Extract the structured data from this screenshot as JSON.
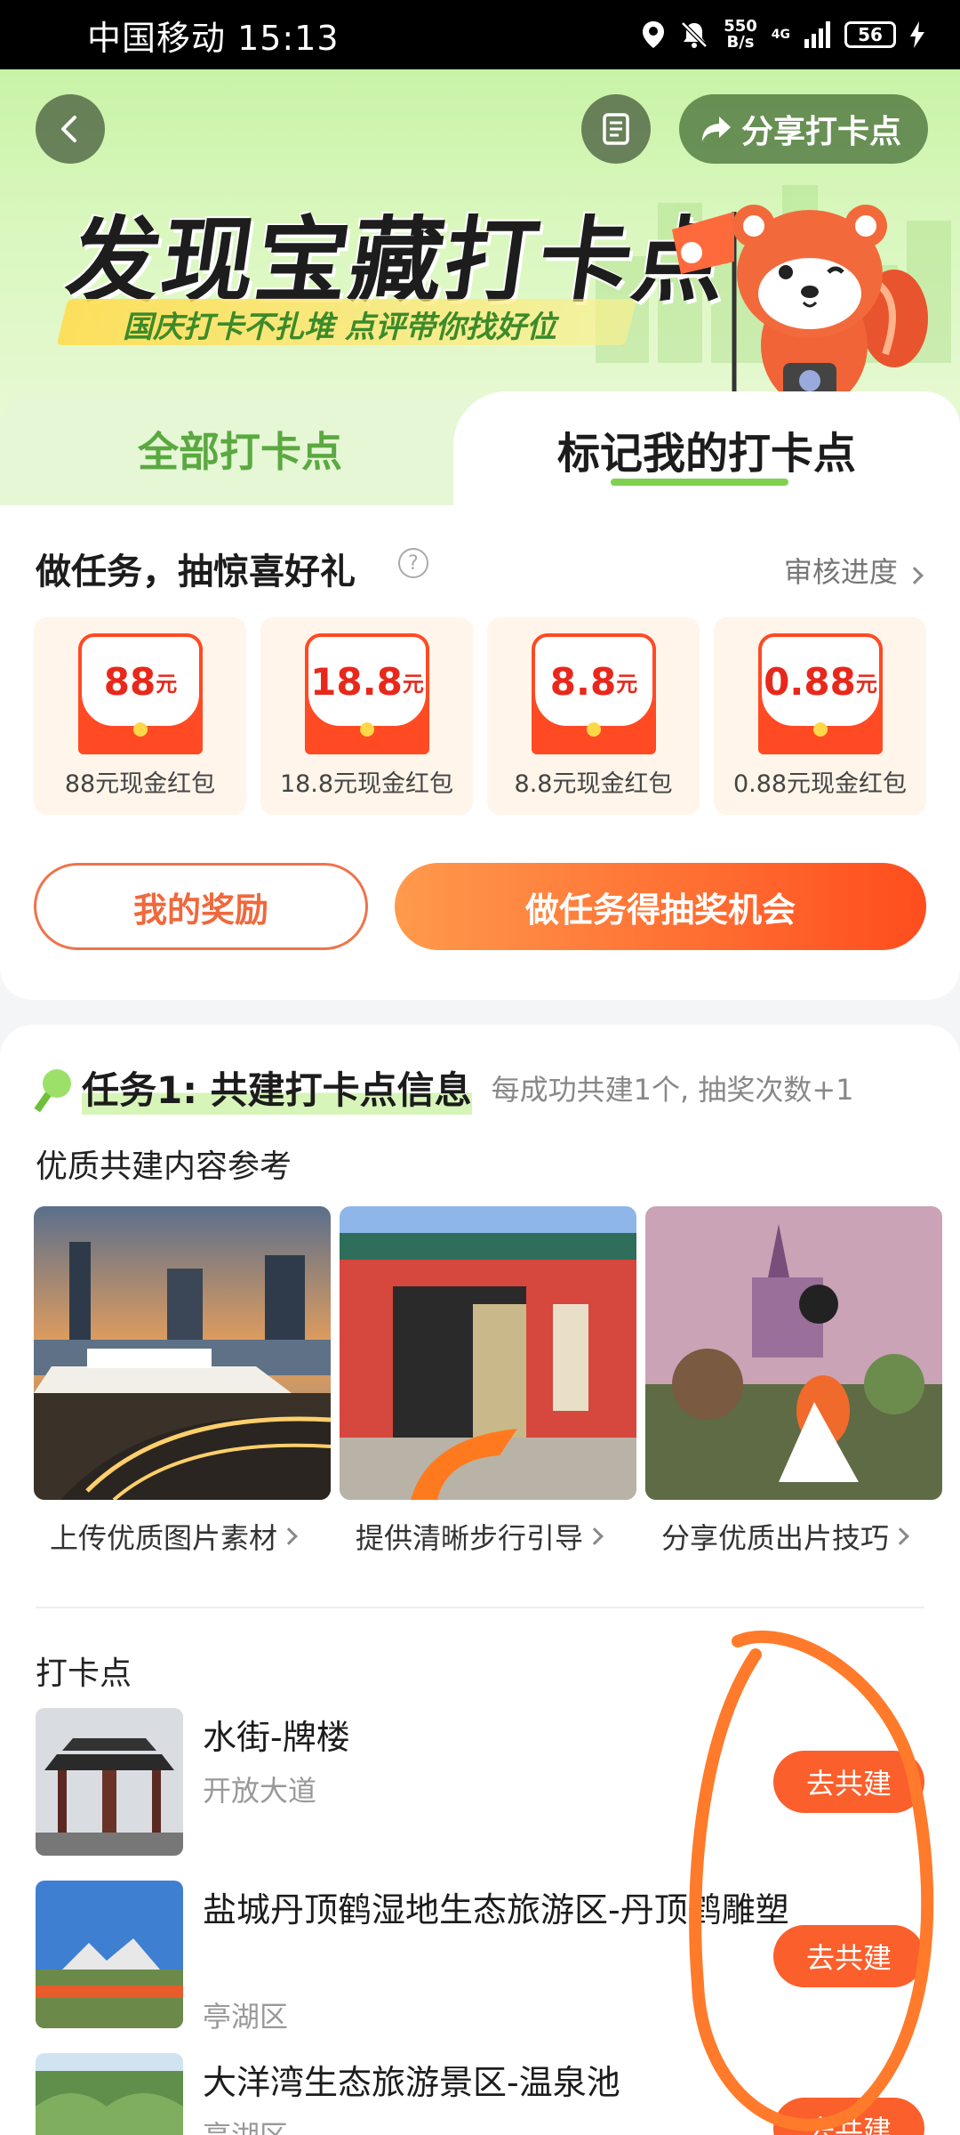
{
  "status_bar": {
    "carrier_time": "中国移动 15:13",
    "net_speed_top": "550",
    "net_speed_bottom": "B/s",
    "network": "4G",
    "battery": "56"
  },
  "header": {
    "share_label": "分享打卡点",
    "title": "发现宝藏打卡点",
    "subtitle": "国庆打卡不扎堆 点评带你找好位"
  },
  "tabs": {
    "all": "全部打卡点",
    "mine": "标记我的打卡点"
  },
  "lottery": {
    "title": "做任务，抽惊喜好礼",
    "review_link": "审核进度",
    "prizes": [
      {
        "amount": "88",
        "unit": "元",
        "label": "88元现金红包"
      },
      {
        "amount": "18.8",
        "unit": "元",
        "label": "18.8元现金红包"
      },
      {
        "amount": "8.8",
        "unit": "元",
        "label": "8.8元现金红包"
      },
      {
        "amount": "0.88",
        "unit": "元",
        "label": "0.88元现金红包"
      }
    ],
    "my_reward": "我的奖励",
    "do_task": "做任务得抽奖机会"
  },
  "task1": {
    "title": "任务1: 共建打卡点信息",
    "desc": "每成功共建1个, 抽奖次数+1",
    "ref_title": "优质共建内容参考",
    "refs": [
      {
        "caption": "上传优质图片素材"
      },
      {
        "caption": "提供清晰步行引导"
      },
      {
        "caption": "分享优质出片技巧"
      }
    ]
  },
  "spots": {
    "title": "打卡点",
    "items": [
      {
        "name": "水街-牌楼",
        "area": "开放大道",
        "action": "去共建"
      },
      {
        "name": "盐城丹顶鹤湿地生态旅游区-丹顶鹤雕塑",
        "area": "亭湖区",
        "action": "去共建"
      },
      {
        "name": "大洋湾生态旅游景区-温泉池",
        "area": "亭湖区",
        "action": "去共建"
      }
    ]
  },
  "colors": {
    "accent_green": "#5aa940",
    "accent_orange": "#fa5f2c",
    "red_packet": "#ff4a24"
  }
}
